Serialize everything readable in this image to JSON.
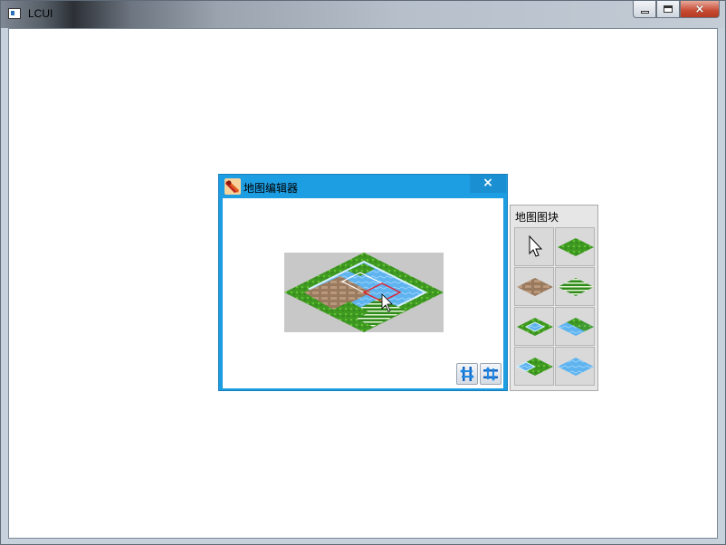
{
  "app": {
    "window_title": "LCUI"
  },
  "editor": {
    "title": "地图编辑器",
    "close_glyph": "×"
  },
  "palette": {
    "title": "地图图块",
    "tiles": [
      {
        "name": "cursor"
      },
      {
        "name": "grass"
      },
      {
        "name": "stone"
      },
      {
        "name": "crop-rows"
      },
      {
        "name": "grass-water-corner"
      },
      {
        "name": "water-grass-corner"
      },
      {
        "name": "water-grass-edge"
      },
      {
        "name": "water"
      }
    ]
  },
  "toolbar": {
    "horizontal_icon": "flip-horizontal-icon",
    "vertical_icon": "flip-vertical-icon"
  },
  "colors": {
    "editor_frame": "#1d9de2",
    "grass": "#3f9a22",
    "water": "#5fb3ee",
    "stone": "#9a7a5e",
    "selection": "#e02030"
  }
}
